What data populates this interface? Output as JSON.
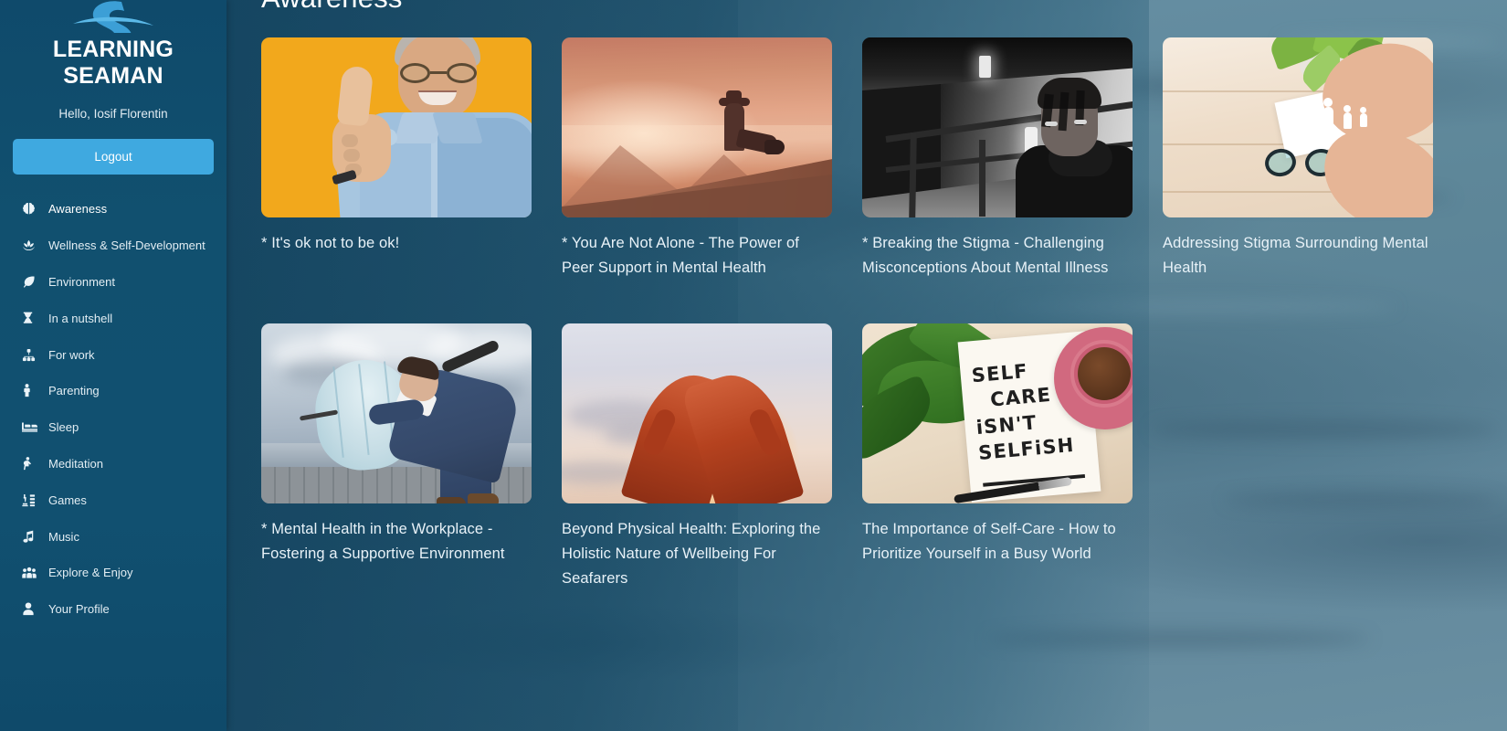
{
  "sidebar": {
    "logo_icon": "seaman-s-logo-icon",
    "brand": "LEARNING SEAMAN",
    "greeting": "Hello, Iosif Florentin",
    "logout_label": "Logout",
    "items": [
      {
        "label": "Awareness",
        "icon": "brain-icon",
        "active": true
      },
      {
        "label": "Wellness & Self-Development",
        "icon": "lotus-icon",
        "active": false
      },
      {
        "label": "Environment",
        "icon": "leaf-icon",
        "active": false
      },
      {
        "label": "In a nutshell",
        "icon": "hourglass-icon",
        "active": false
      },
      {
        "label": "For work",
        "icon": "sitemap-icon",
        "active": false
      },
      {
        "label": "Parenting",
        "icon": "child-icon",
        "active": false
      },
      {
        "label": "Sleep",
        "icon": "bed-icon",
        "active": false
      },
      {
        "label": "Meditation",
        "icon": "praying-person-icon",
        "active": false
      },
      {
        "label": "Games",
        "icon": "chess-icon",
        "active": false
      },
      {
        "label": "Music",
        "icon": "music-note-icon",
        "active": false
      },
      {
        "label": "Explore & Enjoy",
        "icon": "people-group-icon",
        "active": false
      },
      {
        "label": "Your Profile",
        "icon": "user-icon",
        "active": false
      }
    ]
  },
  "main": {
    "page_title": "Awareness",
    "cards": [
      {
        "title": "* It's ok not to be ok!",
        "image": "thumbs-up-man-yellow-background"
      },
      {
        "title": "* You Are Not Alone - The Power of Peer Support in Mental Health",
        "image": "person-sitting-on-mountain-ridge-sunset"
      },
      {
        "title": "* Breaking the Stigma - Challenging Misconceptions About Mental Illness",
        "image": "black-and-white-man-in-corridor-shadows"
      },
      {
        "title": "Addressing Stigma Surrounding Mental Health",
        "image": "hands-around-paper-family-on-desk"
      },
      {
        "title": "* Mental Health in the Workplace - Fostering a Supportive Environment",
        "image": "businessman-with-umbrella-in-storm"
      },
      {
        "title": "Beyond Physical Health: Exploring the Holistic Nature of Wellbeing For Seafarers",
        "image": "hands-raised-to-sun"
      },
      {
        "title": "The Importance of Self-Care - How to Prioritize Yourself in a Busy World",
        "image": "self-care-isnt-selfish-note-with-coffee"
      }
    ],
    "selfcare_note_lines": [
      "SELF",
      "CARE",
      "iSN'T",
      "SELFiSH"
    ]
  },
  "colors": {
    "sidebar_bg": "#11506f",
    "accent_button": "#3fa9e0",
    "page_bg": "#5d8499",
    "card_text": "#e8f2f8",
    "card1_bg": "#f2a81c"
  }
}
